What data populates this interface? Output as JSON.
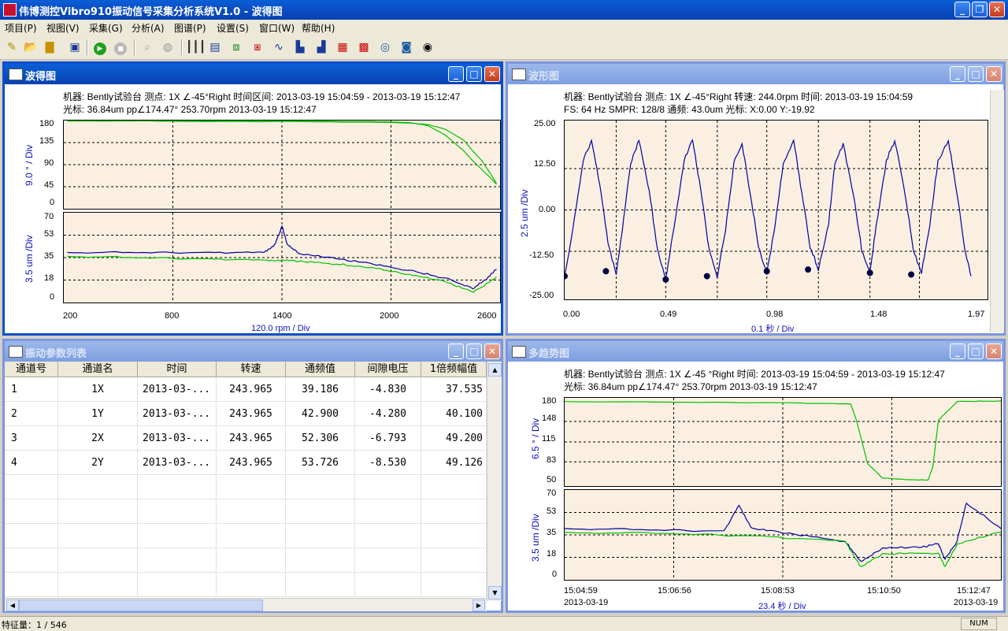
{
  "app": {
    "title": "伟博测控Vibro910振动信号采集分析系统V1.0 - 波得图"
  },
  "menu": [
    "项目(P)",
    "视图(V)",
    "采集(G)",
    "分析(A)",
    "图谱(P)",
    "设置(S)",
    "窗口(W)",
    "帮助(H)"
  ],
  "toolbar": {
    "icons": [
      "new-icon",
      "open-icon",
      "folder-icon",
      "save-icon",
      "play-icon",
      "stop-icon",
      "zoom-in-icon",
      "zoom-out-icon",
      "waterfall-icon",
      "list-icon",
      "trend-icon",
      "multi-trend-icon",
      "waveform-icon",
      "spectrum-icon",
      "cascade-spectrum-icon",
      "color-map-icon",
      "color-map2-icon",
      "orbit-icon",
      "polar-icon",
      "shaft-centerline-icon"
    ]
  },
  "bode": {
    "title": "波得图",
    "info1": "机器: Bently试验台   测点: 1X ∠-45°Right     时间区间: 2013-03-19 15:04:59 - 2013-03-19 15:12:47",
    "info2": "光标: 36.84um pp∠174.47° 253.70rpm  2013-03-19 15:12:47",
    "phase_ylabel": "9.0 ° / Div",
    "phase_ticks": [
      "180",
      "135",
      "90",
      "45",
      "0"
    ],
    "amp_ylabel": "3.5 um /Div",
    "amp_ticks": [
      "70",
      "53",
      "35",
      "18",
      "0"
    ],
    "x_ticks": [
      "200",
      "800",
      "1400",
      "2000",
      "2600"
    ],
    "x_div": "120.0 rpm / Div"
  },
  "wave": {
    "title": "波形图",
    "info1": "机器: Bently试验台   测点: 1X ∠-45°Right   转速: 244.0rpm    时间: 2013-03-19 15:04:59",
    "info2": "FS: 64 Hz    SMPR: 128/8    通频: 43.0um    光标: X:0.00 Y:-19.92",
    "ylabel": "2.5 um /Div",
    "y_ticks": [
      "25.00",
      "12.50",
      "0.00",
      "-12.50",
      "-25.00"
    ],
    "x_ticks": [
      "0.00",
      "0.49",
      "0.98",
      "1.48",
      "1.97"
    ],
    "x_div": "0.1 秒 / Div"
  },
  "params": {
    "title": "振动参数列表",
    "columns": [
      "通道号",
      "通道名",
      "时间",
      "转速",
      "通频值",
      "间隙电压",
      "1倍频幅值"
    ],
    "rows": [
      [
        "1",
        "1X",
        "2013-03-...",
        "243.965",
        "39.186",
        "-4.830",
        "37.535"
      ],
      [
        "2",
        "1Y",
        "2013-03-...",
        "243.965",
        "42.900",
        "-4.280",
        "40.100"
      ],
      [
        "3",
        "2X",
        "2013-03-...",
        "243.965",
        "52.306",
        "-6.793",
        "49.200"
      ],
      [
        "4",
        "2Y",
        "2013-03-...",
        "243.965",
        "53.726",
        "-8.530",
        "49.126"
      ]
    ]
  },
  "trend": {
    "title": "多趋势图",
    "info1": "机器: Bently试验台   测点: 1X ∠-45 °Right    时间: 2013-03-19 15:04:59 - 2013-03-19 15:12:47",
    "info2": "光标: 36.84um    pp∠174.47°  253.70rpm   2013-03-19 15:12:47",
    "phase_ylabel": "6.5 ° / Div",
    "phase_ticks": [
      "180",
      "148",
      "115",
      "83",
      "50"
    ],
    "amp_ylabel": "3.5 um /Div",
    "amp_ticks": [
      "70",
      "53",
      "35",
      "18",
      "0"
    ],
    "x_ticks": [
      "15:04:59",
      "15:06:56",
      "15:08:53",
      "15:10:50",
      "15:12:47"
    ],
    "date_left": "2013-03-19",
    "date_right": "2013-03-19",
    "x_div": "23.4 秒 / Div"
  },
  "status": {
    "text": "特征量：1 / 546",
    "num": "NUM"
  },
  "chart_data": [
    {
      "type": "line",
      "title": "波得图",
      "subplot": "phase",
      "xlabel": "120.0 rpm / Div",
      "ylabel": "9.0 ° / Div",
      "xlim": [
        200,
        2600
      ],
      "ylim": [
        0,
        180
      ],
      "grid": true,
      "series": [
        {
          "color": "#00c000",
          "x": [
            220,
            600,
            1000,
            1400,
            1800,
            2000,
            2100,
            2200,
            2300,
            2400,
            2450,
            2500,
            2550,
            2580
          ],
          "y": [
            179,
            179,
            178,
            178,
            177,
            176,
            175,
            172,
            162,
            140,
            118,
            98,
            70,
            52
          ]
        },
        {
          "color": "#00c000",
          "x": [
            220,
            600,
            1000,
            1400,
            1800,
            2000,
            2100,
            2200,
            2300,
            2400,
            2450,
            2500,
            2550,
            2580
          ],
          "y": [
            180,
            180,
            179,
            179,
            178,
            177,
            176,
            170,
            150,
            118,
            98,
            80,
            62,
            50
          ]
        }
      ]
    },
    {
      "type": "line",
      "title": "波得图",
      "subplot": "amplitude",
      "xlabel": "120.0 rpm / Div",
      "ylabel": "3.5 um /Div",
      "xlim": [
        200,
        2600
      ],
      "ylim": [
        0,
        70
      ],
      "grid": true,
      "series": [
        {
          "color": "#0000a0",
          "x": [
            220,
            600,
            1000,
            1300,
            1360,
            1390,
            1400,
            1430,
            1500,
            1700,
            1900,
            2100,
            2300,
            2450,
            2520,
            2580
          ],
          "y": [
            39,
            39,
            39,
            39,
            45,
            55,
            60,
            45,
            38,
            34,
            30,
            25,
            19,
            11,
            18,
            26
          ]
        },
        {
          "color": "#00c000",
          "x": [
            220,
            600,
            1000,
            1300,
            1400,
            1500,
            1700,
            1900,
            2100,
            2300,
            2450,
            2520,
            2580
          ],
          "y": [
            36,
            35,
            34,
            33,
            33,
            32,
            30,
            27,
            22,
            16,
            8,
            14,
            20
          ]
        }
      ]
    },
    {
      "type": "line",
      "title": "波形图",
      "xlabel": "0.1 秒 / Div",
      "ylabel": "2.5 um /Div",
      "xlim": [
        0,
        2.05
      ],
      "ylim": [
        -27,
        27
      ],
      "grid": true,
      "series": [
        {
          "color": "#0000a0",
          "x": [
            0,
            0.04,
            0.09,
            0.13,
            0.17,
            0.21,
            0.25,
            0.28,
            0.32,
            0.36,
            0.41,
            0.45,
            0.49,
            0.53,
            0.58,
            0.62,
            0.66,
            0.7,
            0.74,
            0.78,
            0.82,
            0.86,
            0.9,
            0.94,
            0.98,
            1.02,
            1.06,
            1.11,
            1.15,
            1.19,
            1.23,
            1.28,
            1.31,
            1.35,
            1.4,
            1.44,
            1.48,
            1.51,
            1.56,
            1.6,
            1.65,
            1.69,
            1.73,
            1.77,
            1.81,
            1.86,
            1.9,
            1.94,
            1.97
          ],
          "y": [
            -19.9,
            -6,
            15,
            21,
            8,
            -10,
            -19,
            -6,
            14,
            21,
            6,
            -12,
            -21,
            -5,
            15,
            21,
            6,
            -12,
            -20,
            -6,
            14,
            20,
            5,
            -11,
            -19,
            -5,
            14,
            21,
            5,
            -11,
            -18,
            -4,
            14,
            20,
            5,
            -12,
            -19,
            -5,
            15,
            21,
            5,
            -12,
            -19,
            -5,
            15,
            21,
            6,
            -12,
            -20
          ]
        },
        {
          "type": "scatter",
          "name": "keyphasor",
          "x": [
            0.0,
            0.2,
            0.49,
            0.69,
            0.98,
            1.18,
            1.48,
            1.68
          ],
          "y": [
            -20,
            -18.5,
            -21,
            -20,
            -18.5,
            -18,
            -19,
            -19.5
          ]
        }
      ]
    },
    {
      "type": "line",
      "title": "多趋势图",
      "subplot": "phase",
      "xlabel": "23.4 秒 / Div",
      "ylabel": "6.5 ° / Div",
      "xlim": [
        "15:04:59",
        "15:12:47"
      ],
      "ylim": [
        44,
        186
      ],
      "grid": true,
      "series": [
        {
          "color": "#00c000",
          "x": [
            "15:04:59",
            "15:07:00",
            "15:09:00",
            "15:10:06",
            "15:10:12",
            "15:10:24",
            "15:10:40",
            "15:11:10",
            "15:11:29",
            "15:11:34",
            "15:11:40",
            "15:12:00",
            "15:12:47"
          ],
          "y": [
            180,
            179,
            178,
            176,
            150,
            80,
            57,
            54,
            54,
            75,
            150,
            180,
            181
          ]
        }
      ]
    },
    {
      "type": "line",
      "title": "多趋势图",
      "subplot": "amplitude",
      "xlabel": "23.4 秒 / Div",
      "ylabel": "3.5 um /Div",
      "xlim": [
        "15:04:59",
        "15:12:47"
      ],
      "ylim": [
        0,
        70
      ],
      "grid": true,
      "series": [
        {
          "color": "#0000a0",
          "x": [
            "15:04:59",
            "15:06:30",
            "15:07:50",
            "15:08:06",
            "15:08:20",
            "15:09:00",
            "15:10:00",
            "15:10:17",
            "15:10:40",
            "15:11:20",
            "15:11:40",
            "15:11:47",
            "15:12:00",
            "15:12:10",
            "15:12:47"
          ],
          "y": [
            40,
            39,
            38,
            58,
            40,
            36,
            30,
            14,
            25,
            25,
            28,
            16,
            30,
            60,
            40
          ]
        },
        {
          "color": "#00c000",
          "x": [
            "15:04:59",
            "15:07:00",
            "15:08:30",
            "15:10:00",
            "15:10:17",
            "15:10:40",
            "15:11:40",
            "15:11:47",
            "15:12:00",
            "15:12:47"
          ],
          "y": [
            37,
            36,
            34,
            30,
            10,
            20,
            21,
            10,
            28,
            37
          ]
        }
      ]
    }
  ]
}
